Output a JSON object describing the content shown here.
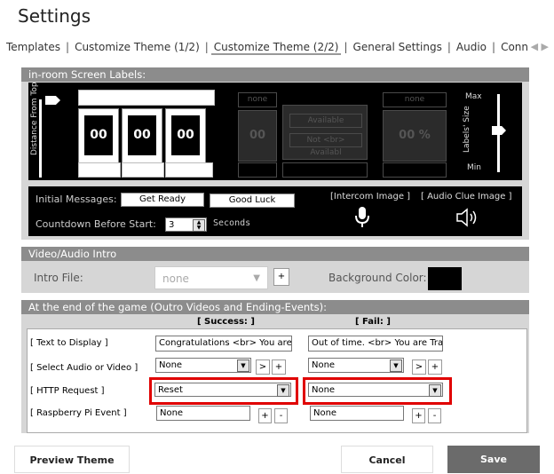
{
  "page_title": "Settings",
  "tabs": [
    {
      "label": "Templates"
    },
    {
      "label": "Customize Theme  (1/2)"
    },
    {
      "label": "Customize Theme  (2/2)"
    },
    {
      "label": "General Settings"
    },
    {
      "label": "Audio"
    },
    {
      "label": "Conn"
    }
  ],
  "labels_panel": {
    "header": "in-room Screen Labels:",
    "distance_label": "Distance From Top",
    "size_label": "Labels' Size",
    "max_label": "Max",
    "min_label": "Min",
    "digits": [
      "00",
      "00",
      "00"
    ],
    "ghost_top1": "none",
    "ghost_top2": "none",
    "ghost_digit": "00",
    "ghost_available": "Available",
    "ghost_not_available": "Not <br> Availabl",
    "ghost_percent": "00 %"
  },
  "initial_messages": {
    "label": "Initial Messages:",
    "get_ready": "Get Ready",
    "good_luck": "Good Luck",
    "countdown_label": "Countdown Before Start:",
    "countdown_value": "3",
    "seconds_label": "Seconds",
    "intercom_label": "[Intercom Image ]",
    "audio_clue_label": "[ Audio Clue Image ]"
  },
  "video_intro": {
    "header": "Video/Audio Intro",
    "intro_label": "Intro File:",
    "intro_value": "none",
    "plus": "+",
    "bg_color_label": "Background Color:",
    "bg_color": "#000000"
  },
  "outro": {
    "header": "At the end of the game (Outro Videos and Ending-Events):",
    "success_header": "[ Success: ]",
    "fail_header": "[ Fail: ]",
    "rows": {
      "text_label": "[ Text to Display ]",
      "audio_label": "[ Select Audio or Video ]",
      "http_label": "[ HTTP Request ]",
      "pi_label": "[ Raspberry Pi Event ]"
    },
    "success": {
      "text": "Congratulations <br> You are",
      "audio": "None",
      "http": "Reset",
      "pi": "None"
    },
    "fail": {
      "text": "Out of time. <br> You are Trap",
      "audio": "None",
      "http": "None",
      "pi": "None"
    },
    "btn_gt": ">",
    "btn_plus": "+",
    "btn_minus": "-"
  },
  "footer": {
    "preview": "Preview Theme",
    "cancel": "Cancel",
    "save": "Save"
  },
  "colors": {
    "highlight": "#e00000",
    "save_bg": "#6b6b6b"
  }
}
